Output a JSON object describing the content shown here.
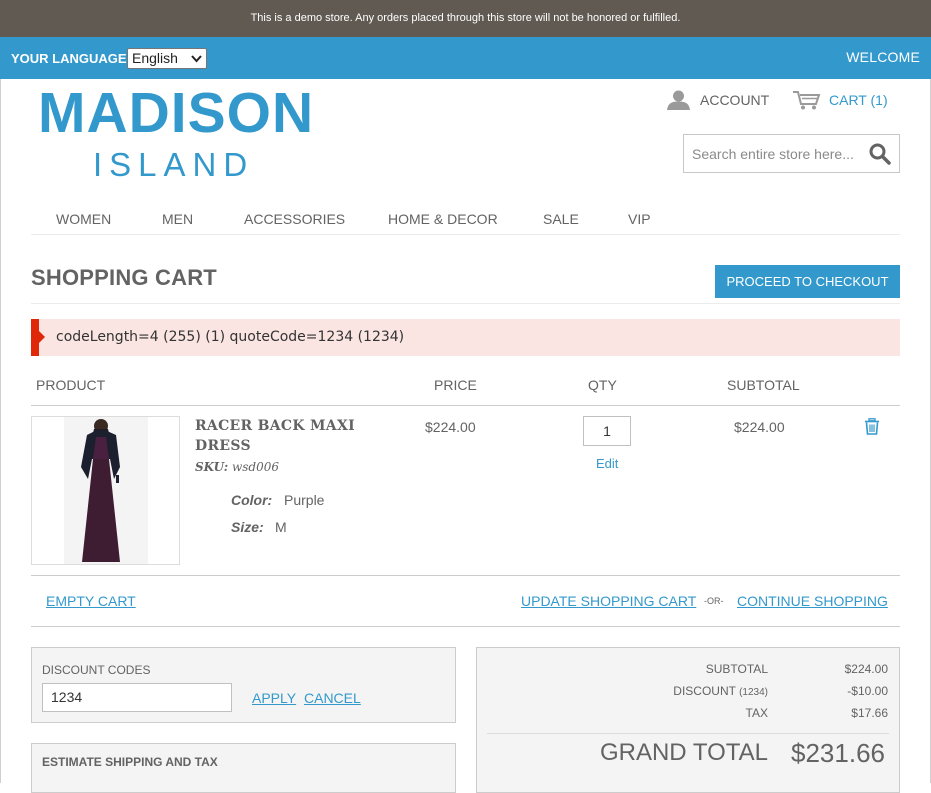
{
  "demo_notice": "This is a demo store. Any orders placed through this store will not be honored or fulfilled.",
  "language": {
    "label": "YOUR LANGUAGE:",
    "selected": "English"
  },
  "welcome": "WELCOME",
  "logo": {
    "top": "MADISON",
    "bottom": "ISLAND"
  },
  "header": {
    "account_label": "ACCOUNT",
    "cart_label": "CART (1)",
    "search_placeholder": "Search entire store here..."
  },
  "nav": [
    "WOMEN",
    "MEN",
    "ACCESSORIES",
    "HOME & DECOR",
    "SALE",
    "VIP"
  ],
  "page": {
    "title": "SHOPPING CART",
    "checkout_label": "PROCEED TO CHECKOUT"
  },
  "message": "codeLength=4 (255) (1) quoteCode=1234 (1234)",
  "table": {
    "headers": {
      "product": "PRODUCT",
      "price": "PRICE",
      "qty": "QTY",
      "subtotal": "SUBTOTAL"
    },
    "item": {
      "name": "RACER BACK MAXI DRESS",
      "sku_label": "SKU:",
      "sku": "wsd006",
      "options": [
        {
          "label": "Color:",
          "value": "Purple"
        },
        {
          "label": "Size:",
          "value": "M"
        }
      ],
      "price": "$224.00",
      "qty": "1",
      "edit_label": "Edit",
      "subtotal": "$224.00"
    }
  },
  "actions": {
    "empty": "EMPTY CART",
    "update": "UPDATE SHOPPING CART",
    "or": "-OR-",
    "continue": "CONTINUE SHOPPING"
  },
  "discount": {
    "label": "DISCOUNT CODES",
    "value": "1234",
    "apply": "APPLY",
    "cancel": "CANCEL"
  },
  "shipping": {
    "label": "ESTIMATE SHIPPING AND TAX"
  },
  "totals": {
    "subtotal_label": "SUBTOTAL",
    "subtotal": "$224.00",
    "discount_label": "DISCOUNT",
    "discount_code": "(1234)",
    "discount": "-$10.00",
    "tax_label": "TAX",
    "tax": "$17.66",
    "grand_label": "GRAND TOTAL",
    "grand": "$231.66"
  },
  "colors": {
    "accent": "#3399cc",
    "demo_bar": "#605a52",
    "error_bg": "#fae5e2",
    "error_border": "#df280a"
  }
}
